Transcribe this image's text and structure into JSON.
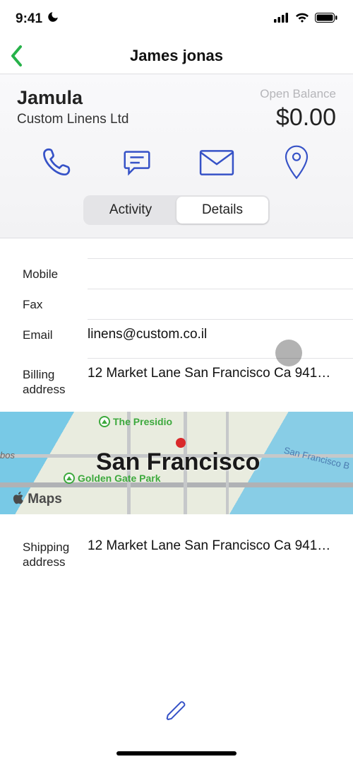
{
  "status": {
    "time": "9:41"
  },
  "nav": {
    "title": "James jonas"
  },
  "customer": {
    "name": "Jamula",
    "company": "Custom Linens Ltd"
  },
  "balance": {
    "label": "Open Balance",
    "value": "$0.00"
  },
  "tabs": {
    "activity": "Activity",
    "details": "Details"
  },
  "fields": {
    "mobile": {
      "label": "Mobile",
      "value": ""
    },
    "fax": {
      "label": "Fax",
      "value": ""
    },
    "email": {
      "label": "Email",
      "value": "linens@custom.co.il"
    },
    "billing": {
      "label": "Billing address",
      "value": "12 Market Lane San Francisco Ca 941…"
    },
    "shipping": {
      "label": "Shipping address",
      "value": "12 Market Lane San Francisco Ca 941…"
    }
  },
  "map": {
    "city": "San Francisco",
    "poi1": "The Presidio",
    "poi2": "Golden Gate Park",
    "brand": "Maps",
    "bay": "San Francisco B",
    "edge": "bos"
  }
}
